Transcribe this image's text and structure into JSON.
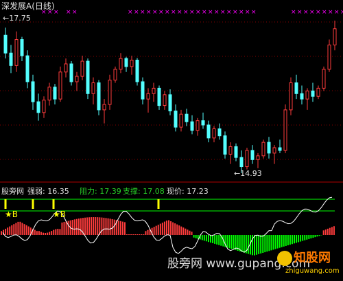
{
  "title": "深发展A(日线)",
  "main_panel": {
    "high_label": "17.75",
    "low_label": "14.93",
    "candles": [
      [
        17.48,
        17.62,
        17.05,
        17.15
      ],
      [
        17.15,
        17.3,
        16.78,
        16.92
      ],
      [
        16.92,
        17.55,
        16.8,
        17.4
      ],
      [
        17.4,
        17.45,
        17.0,
        17.1
      ],
      [
        17.1,
        17.2,
        16.5,
        16.62
      ],
      [
        16.62,
        16.75,
        16.1,
        16.25
      ],
      [
        16.25,
        16.4,
        15.9,
        16.05
      ],
      [
        16.05,
        16.35,
        15.95,
        16.28
      ],
      [
        16.28,
        16.6,
        16.18,
        16.52
      ],
      [
        16.52,
        16.58,
        16.2,
        16.3
      ],
      [
        16.3,
        16.9,
        16.25,
        16.8
      ],
      [
        16.8,
        17.05,
        16.7,
        16.95
      ],
      [
        16.95,
        17.0,
        16.55,
        16.62
      ],
      [
        16.62,
        16.8,
        16.45,
        16.72
      ],
      [
        16.72,
        17.1,
        16.65,
        17.0
      ],
      [
        17.0,
        17.05,
        16.3,
        16.4
      ],
      [
        16.4,
        16.7,
        16.2,
        16.6
      ],
      [
        16.6,
        16.65,
        16.0,
        16.1
      ],
      [
        16.1,
        16.3,
        15.85,
        16.2
      ],
      [
        16.2,
        16.75,
        16.1,
        16.65
      ],
      [
        16.65,
        16.9,
        16.6,
        16.85
      ],
      [
        16.85,
        17.15,
        16.78,
        17.05
      ],
      [
        17.05,
        17.08,
        16.8,
        16.9
      ],
      [
        16.9,
        17.1,
        16.75,
        17.02
      ],
      [
        17.02,
        17.06,
        16.55,
        16.62
      ],
      [
        16.62,
        16.7,
        16.2,
        16.3
      ],
      [
        16.3,
        16.5,
        16.05,
        16.4
      ],
      [
        16.4,
        16.6,
        16.25,
        16.5
      ],
      [
        16.5,
        16.55,
        16.1,
        16.18
      ],
      [
        16.18,
        16.45,
        16.1,
        16.38
      ],
      [
        16.38,
        16.48,
        16.0,
        16.08
      ],
      [
        16.08,
        16.2,
        15.7,
        15.78
      ],
      [
        15.78,
        16.1,
        15.7,
        16.02
      ],
      [
        16.02,
        16.12,
        15.8,
        15.88
      ],
      [
        15.88,
        16.0,
        15.65,
        15.72
      ],
      [
        15.72,
        15.95,
        15.62,
        15.9
      ],
      [
        15.9,
        16.05,
        15.75,
        15.82
      ],
      [
        15.82,
        15.9,
        15.5,
        15.58
      ],
      [
        15.58,
        15.8,
        15.5,
        15.75
      ],
      [
        15.75,
        15.85,
        15.55,
        15.62
      ],
      [
        15.62,
        15.7,
        15.2,
        15.28
      ],
      [
        15.28,
        15.5,
        15.1,
        15.42
      ],
      [
        15.42,
        15.48,
        15.15,
        15.22
      ],
      [
        15.22,
        15.35,
        14.93,
        15.05
      ],
      [
        15.05,
        15.4,
        15.0,
        15.35
      ],
      [
        15.35,
        15.45,
        15.1,
        15.18
      ],
      [
        15.18,
        15.3,
        15.02,
        15.25
      ],
      [
        15.25,
        15.55,
        15.2,
        15.5
      ],
      [
        15.5,
        15.6,
        15.2,
        15.3
      ],
      [
        15.3,
        15.45,
        15.1,
        15.4
      ],
      [
        15.4,
        15.55,
        15.3,
        15.35
      ],
      [
        15.35,
        16.2,
        15.3,
        16.1
      ],
      [
        16.1,
        16.7,
        16.0,
        16.6
      ],
      [
        16.6,
        16.75,
        16.3,
        16.4
      ],
      [
        16.4,
        16.55,
        16.2,
        16.3
      ],
      [
        16.3,
        16.5,
        16.1,
        16.45
      ],
      [
        16.45,
        16.6,
        16.25,
        16.35
      ],
      [
        16.35,
        16.55,
        16.3,
        16.5
      ],
      [
        16.5,
        16.9,
        16.45,
        16.85
      ],
      [
        16.85,
        17.4,
        16.8,
        17.3
      ],
      [
        17.3,
        17.75,
        17.2,
        17.6
      ]
    ]
  },
  "indicator_panel": {
    "brand": "股旁网",
    "strength_label": "强弱",
    "strength_value": "16.35",
    "resistance_label": "阻力:",
    "resistance_value": "17.39",
    "support_label": "支撑:",
    "support_value": "17.08",
    "price_label": "现价:",
    "price_value": "17.23",
    "signal_marker": "B"
  },
  "watermark": {
    "text": "股旁网 www.gupang.com",
    "logo": "知股网",
    "logo_url": "zhiguwang.com"
  },
  "colors": {
    "up": "#ff3c3c",
    "down": "#54ffff",
    "magenta": "#ff00ff",
    "green": "#00ff00",
    "yellow": "#ffff00",
    "white": "#ffffff"
  }
}
